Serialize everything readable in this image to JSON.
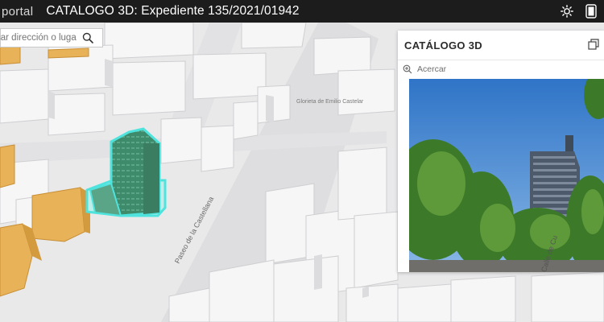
{
  "header": {
    "brand": "portal",
    "title": "CATALOGO 3D: Expediente 135/2021/01942",
    "icons": [
      "sun-icon",
      "device-icon"
    ]
  },
  "search": {
    "placeholder": "car dirección o lugar",
    "icon": "search-icon"
  },
  "map": {
    "street_labels": [
      "Paseo de la Castellana",
      "Calle de Cu"
    ],
    "place_labels": [
      "Glorieta de Emilio Castelar"
    ],
    "colors": {
      "selected_building": "#4f9478",
      "highlight_outline": "#4fe3dd",
      "catalogued_buildings": "#e8b258",
      "buildings": "#f4f4f4",
      "ground": "#e9e9ea"
    }
  },
  "panel": {
    "title": "CATÁLOGO 3D",
    "dock_icon": "dock-icon",
    "zoom_icon": "zoom-in-icon",
    "zoom_label": "Acercar"
  }
}
